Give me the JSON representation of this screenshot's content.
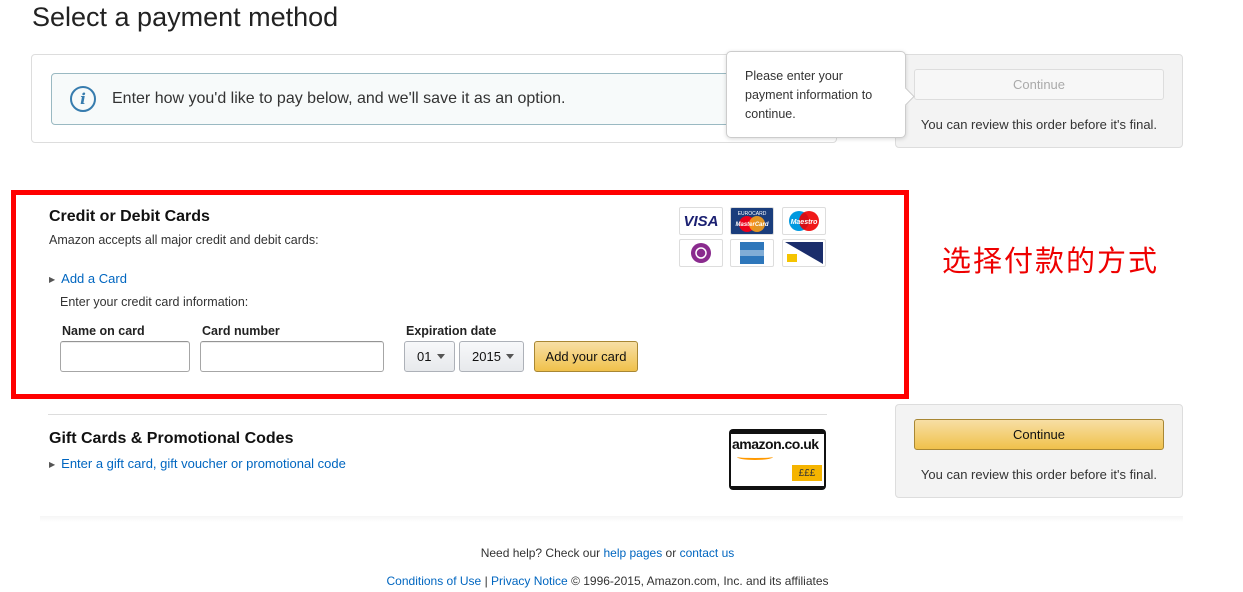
{
  "page": {
    "title": "Select a payment method"
  },
  "info_banner": {
    "text": "Enter how you'd like to pay below, and we'll save it as an option."
  },
  "tooltip": {
    "text": "Please enter your payment information to continue."
  },
  "side_top": {
    "button_label": "Continue",
    "button_state": "disabled",
    "note": "You can review this order before it's final."
  },
  "side_bottom": {
    "button_label": "Continue",
    "button_state": "enabled",
    "note": "You can review this order before it's final."
  },
  "cards": {
    "title": "Credit or Debit Cards",
    "subtitle": "Amazon accepts all major credit and debit cards:",
    "add_card_link": "Add a Card",
    "enter_info": "Enter your credit card information:",
    "name_label": "Name on card",
    "number_label": "Card number",
    "expiration_label": "Expiration date",
    "month_value": "01",
    "year_value": "2015",
    "add_button": "Add your card",
    "logos": [
      {
        "name": "visa-logo",
        "text": "VISA"
      },
      {
        "name": "mastercard-logo",
        "text": "MasterCard"
      },
      {
        "name": "maestro-logo",
        "text": "Maestro"
      },
      {
        "name": "solo-logo",
        "text": ""
      },
      {
        "name": "american-express-logo",
        "text": ""
      },
      {
        "name": "delta-logo",
        "text": ""
      }
    ]
  },
  "annotation": {
    "text": "选择付款的方式",
    "color": "#e00000"
  },
  "gift": {
    "title": "Gift Cards & Promotional Codes",
    "link": "Enter a gift card, gift voucher or promotional code",
    "card_brand": "amazon.co.uk",
    "card_amount": "£££"
  },
  "footer": {
    "help_prefix": "Need help? Check our",
    "help_pages": "help pages",
    "or": "or",
    "contact_us": "contact us",
    "conditions": "Conditions of Use",
    "separator": "|",
    "privacy": "Privacy Notice",
    "copyright": "© 1996-2015, Amazon.com, Inc. and its affiliates"
  },
  "colors": {
    "link": "#0066c0",
    "button_yellow": "#f0c14b",
    "highlight_border": "#ff0000"
  }
}
